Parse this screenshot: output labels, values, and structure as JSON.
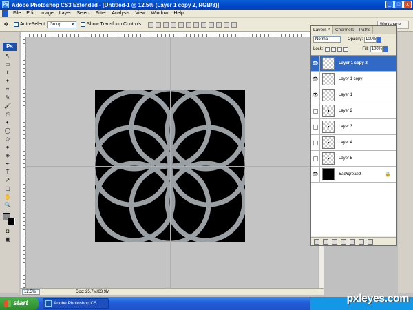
{
  "window": {
    "title": "Adobe Photoshop CS3 Extended - [Untitled-1 @ 12.5% (Layer 1 copy 2, RGB/8)]",
    "buttons": [
      "_",
      "□",
      "x"
    ]
  },
  "menubar": {
    "items": [
      "File",
      "Edit",
      "Image",
      "Layer",
      "Select",
      "Filter",
      "Analysis",
      "View",
      "Window",
      "Help"
    ]
  },
  "options": {
    "auto_select_label": "Auto-Select:",
    "auto_select_value": "Group",
    "transform_label": "Show Transform Controls",
    "workspace_label": "Workspace"
  },
  "toolbox": {
    "badge": "Ps",
    "tools": [
      "↖",
      "▭",
      "ℓ",
      "✦",
      "⌗",
      "✎",
      "🖌",
      "⎘",
      "◐",
      "◯",
      "◇",
      "●",
      "◈",
      "✒",
      "T",
      "↗",
      "▢",
      "✋",
      "🔍"
    ]
  },
  "statusbar": {
    "zoom": "12.5%",
    "doc_info": "Doc: 25.7M/63.9M"
  },
  "layers_panel": {
    "tabs": [
      "Layers",
      "Channels",
      "Paths"
    ],
    "blend_mode": "Normal",
    "opacity_label": "Opacity:",
    "opacity_value": "100%",
    "lock_label": "Lock:",
    "fill_label": "Fill:",
    "fill_value": "100%",
    "layers": [
      {
        "name": "Layer 1 copy 2",
        "visible": true,
        "selected": true
      },
      {
        "name": "Layer 1 copy",
        "visible": true,
        "selected": false
      },
      {
        "name": "Layer 1",
        "visible": true,
        "selected": false
      },
      {
        "name": "Layer 2",
        "visible": false,
        "selected": false
      },
      {
        "name": "Layer 3",
        "visible": false,
        "selected": false
      },
      {
        "name": "Layer 4",
        "visible": false,
        "selected": false
      },
      {
        "name": "Layer 5",
        "visible": false,
        "selected": false
      },
      {
        "name": "Background",
        "visible": true,
        "selected": false
      }
    ]
  },
  "taskbar": {
    "start_label": "start",
    "task_label": "Adobe Photoshop CS..."
  },
  "watermark": "pxleyes.com",
  "colors": {
    "ring": "#9aa0a3",
    "guide": "#5ecfe0",
    "selection": "#3169c6"
  }
}
